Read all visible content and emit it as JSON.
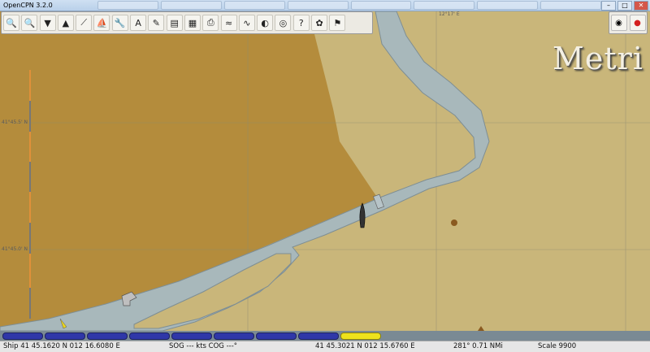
{
  "window": {
    "title": "OpenCPN 3.2.0"
  },
  "browser_tabs": [
    "",
    "",
    "",
    "",
    "",
    "",
    "",
    ""
  ],
  "toolbar": {
    "buttons": [
      {
        "name": "zoom-in-icon",
        "glyph": "🔍"
      },
      {
        "name": "zoom-out-icon",
        "glyph": "🔍"
      },
      {
        "name": "scale-in-icon",
        "glyph": "▼"
      },
      {
        "name": "scale-out-icon",
        "glyph": "▲"
      },
      {
        "name": "route-icon",
        "glyph": "⟋"
      },
      {
        "name": "auto-follow-icon",
        "glyph": "⛵"
      },
      {
        "name": "settings-icon",
        "glyph": "🔧"
      },
      {
        "name": "text-icon",
        "glyph": "A"
      },
      {
        "name": "current-icon",
        "glyph": "✎"
      },
      {
        "name": "chart-quilt-icon",
        "glyph": "▤"
      },
      {
        "name": "route-manager-icon",
        "glyph": "▦"
      },
      {
        "name": "print-icon",
        "glyph": "⎙"
      },
      {
        "name": "tide-icon",
        "glyph": "≈"
      },
      {
        "name": "track-icon",
        "glyph": "∿"
      },
      {
        "name": "color-scheme-icon",
        "glyph": "◐"
      },
      {
        "name": "mob-icon",
        "glyph": "◎"
      },
      {
        "name": "help-icon",
        "glyph": "?"
      },
      {
        "name": "plugin-icon",
        "glyph": "✿"
      },
      {
        "name": "ais-icon",
        "glyph": "⚑"
      }
    ]
  },
  "right_toolbar": {
    "buttons": [
      {
        "name": "compass-icon",
        "glyph": "◉"
      },
      {
        "name": "gps-status-icon",
        "glyph": "●"
      }
    ]
  },
  "chart": {
    "place_label": "Metri",
    "lon_tick": "12°17' E",
    "lat_ticks": [
      "41°45.5' N",
      "41°45.0' N"
    ],
    "colors": {
      "land": "#c9b67a",
      "land_dark": "#b48c3c",
      "water": "#a8b8bb",
      "water_edge": "#7e8e94",
      "grid": "#8a8a72"
    }
  },
  "piano": {
    "keys": 9,
    "active_index": 8
  },
  "status": {
    "ship": "Ship 41 45.1620 N   012 16.6080 E",
    "sog_cog": "SOG --- kts   COG ---°",
    "cursor": "41 45.3021 N   012 15.6760 E",
    "bearing_dist": "281°  0.71 NMi",
    "scale": "Scale 9900"
  }
}
